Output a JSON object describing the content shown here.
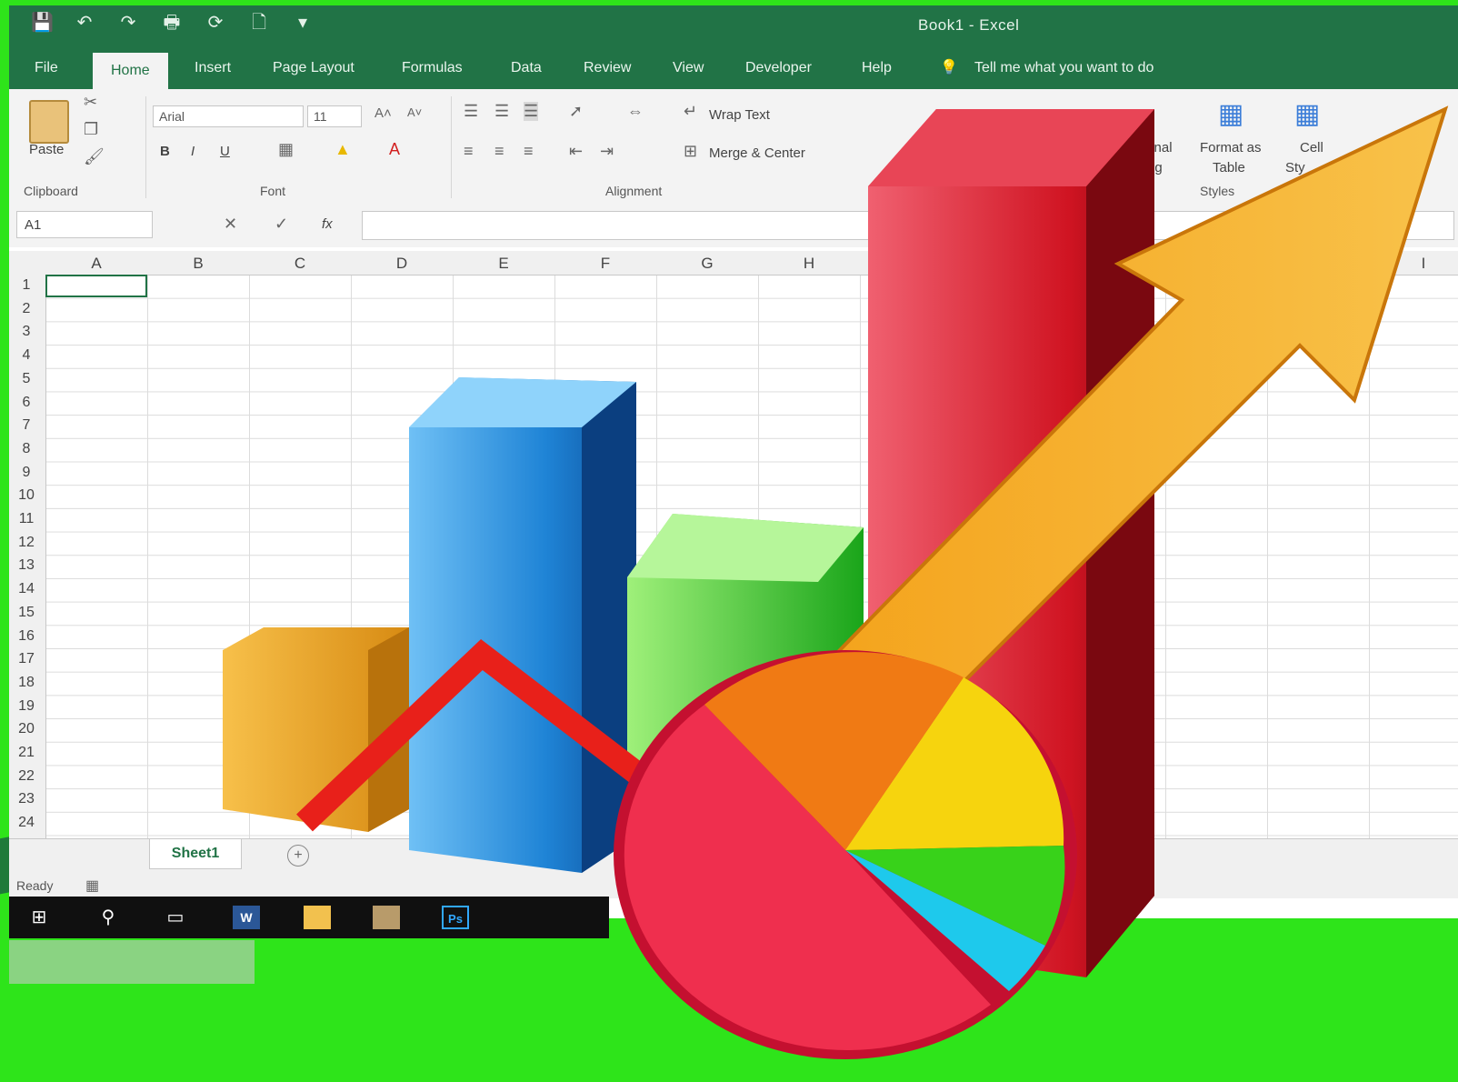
{
  "window": {
    "title": "Book1 - Excel"
  },
  "menu": {
    "tabs": [
      "File",
      "Home",
      "Insert",
      "Page Layout",
      "Formulas",
      "Data",
      "Review",
      "View",
      "Developer",
      "Help"
    ],
    "active": "Home",
    "tell_me": "Tell me what you want to do"
  },
  "ribbon": {
    "clipboard": {
      "paste_label": "Paste",
      "group_label": "Clipboard"
    },
    "font": {
      "name": "Arial",
      "size": "11",
      "group_label": "Font",
      "bold": "B",
      "italic": "I",
      "underline": "U"
    },
    "alignment": {
      "wrap_text": "Wrap Text",
      "merge_center": "Merge & Center",
      "group_label": "Alignment"
    },
    "styles": {
      "conditional": "ditional",
      "conditional_2": "atting",
      "format_table": "Format as",
      "format_table_2": "Table",
      "cell_styles": "Cell",
      "cell_styles_2": "Sty",
      "group_label": "Styles"
    }
  },
  "formula_bar": {
    "name_box": "A1",
    "fx": "fx"
  },
  "grid": {
    "columns": [
      "A",
      "B",
      "C",
      "D",
      "E",
      "F",
      "G",
      "H",
      "I"
    ],
    "rows": [
      "1",
      "2",
      "3",
      "4",
      "5",
      "6",
      "7",
      "8",
      "9",
      "10",
      "11",
      "12",
      "13",
      "14",
      "15",
      "16",
      "17",
      "18",
      "19",
      "20",
      "21",
      "22",
      "23",
      "24"
    ]
  },
  "sheets": {
    "tabs": [
      "Sheet1"
    ],
    "add": "+"
  },
  "status": {
    "text": "Ready"
  },
  "taskbar": {
    "items": [
      "start-icon",
      "search-icon",
      "task-view-icon",
      "word-icon",
      "folder-icon",
      "photos-icon",
      "photoshop-icon"
    ],
    "word": "W",
    "ps": "Ps"
  },
  "colors": {
    "excel_green": "#217346",
    "background_green": "#2ee41a"
  },
  "illustration": {
    "elements": [
      "orange-bar",
      "blue-bar",
      "green-bar",
      "red-bar",
      "red-line",
      "orange-arrow",
      "pie-chart"
    ]
  }
}
